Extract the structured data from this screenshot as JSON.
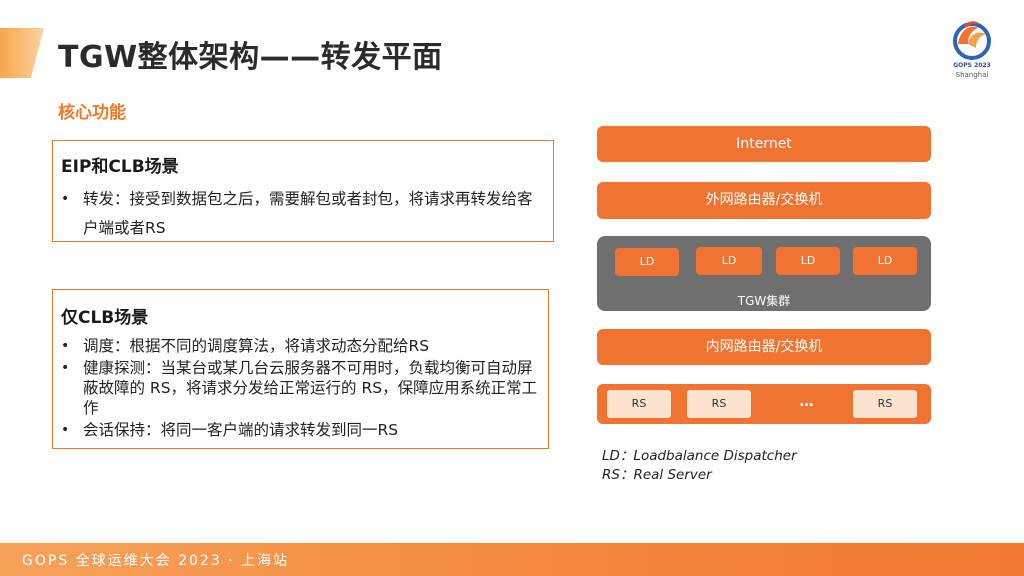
{
  "slide": {
    "title": "TGW整体架构——转发平面",
    "section_label": "核心功能"
  },
  "logo": {
    "line1": "GOPS 2023",
    "line2": "Shanghai"
  },
  "eip_box": {
    "title": "EIP和CLB场景",
    "bullets": [
      "转发：接受到数据包之后，需要解包或者封包，将请求再转发给客户端或者RS"
    ]
  },
  "clb_box": {
    "title": "仅CLB场景",
    "bullets": [
      "调度：根据不同的调度算法，将请求动态分配给RS",
      "健康探测：当某台或某几台云服务器不可用时，负载均衡可自动屏蔽故障的 RS，将请求分发给正常运行的 RS，保障应用系统正常工作",
      "会话保持：将同一客户端的请求转发到同一RS"
    ]
  },
  "diagram": {
    "internet": "Internet",
    "outer_router": "外网路由器/交换机",
    "cluster": {
      "nodes": [
        "LD",
        "LD",
        "LD",
        "LD"
      ],
      "label": "TGW集群"
    },
    "inner_router": "内网路由器/交换机",
    "servers": [
      "RS",
      "RS",
      "RS"
    ],
    "ellipsis": "…",
    "legend": [
      "LD：Loadbalance Dispatcher",
      "RS：Real Server"
    ],
    "colors": {
      "accent": "#f07332",
      "cluster_bg": "#6f6f6f",
      "rs_bg": "#fce3d0"
    }
  },
  "footer": {
    "text": "GOPS 全球运维大会 2023 · 上海站"
  }
}
